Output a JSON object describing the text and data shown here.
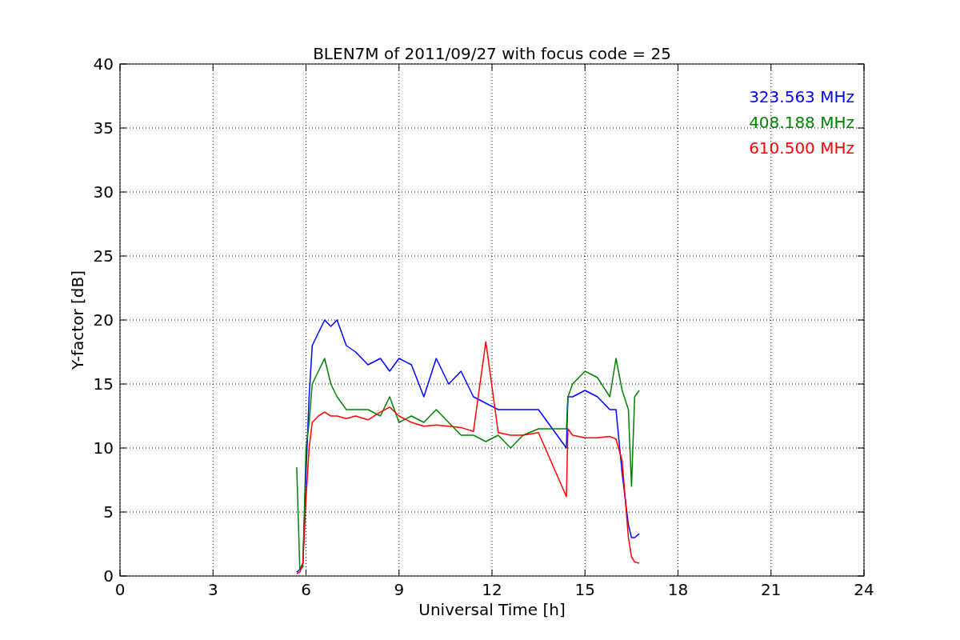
{
  "figure": {
    "chart_data": {
      "type": "line",
      "title": "BLEN7M of 2011/09/27 with focus code = 25",
      "xlabel": "Universal Time [h]",
      "ylabel": "Y-factor [dB]",
      "x": [
        5.7,
        5.8,
        5.9,
        6.0,
        6.1,
        6.2,
        6.4,
        6.6,
        6.8,
        7.0,
        7.3,
        7.6,
        8.0,
        8.4,
        8.7,
        9.0,
        9.4,
        9.8,
        10.2,
        10.6,
        11.0,
        11.4,
        11.8,
        12.2,
        12.6,
        13.0,
        13.5,
        14.4,
        14.45,
        14.6,
        15.0,
        15.4,
        15.8,
        16.0,
        16.2,
        16.4,
        16.5,
        16.6,
        16.75
      ],
      "series": [
        {
          "name": "323.563 MHz",
          "color": "#0000ff",
          "values": [
            0.3,
            0.5,
            1.0,
            8,
            14,
            18,
            19,
            20,
            19.5,
            20,
            18,
            17.5,
            16.5,
            17,
            16,
            17,
            16.5,
            14,
            17,
            15,
            16,
            14,
            13.5,
            13,
            13,
            13,
            13,
            10,
            14,
            14,
            14.5,
            14,
            13,
            13,
            8,
            4,
            3,
            3,
            3.3
          ]
        },
        {
          "name": "408.188 MHz",
          "color": "#008000",
          "values": [
            8.5,
            0.5,
            0.7,
            10,
            12,
            15,
            16,
            17,
            15,
            14,
            13,
            13,
            13,
            12.5,
            14,
            12,
            12.5,
            12,
            13,
            12,
            11,
            11,
            10.5,
            11,
            10,
            11,
            11.5,
            11.5,
            14,
            15,
            16,
            15.5,
            14,
            17,
            14.5,
            13,
            7,
            14,
            14.5
          ]
        },
        {
          "name": "610.500 MHz",
          "color": "#ff0000",
          "values": [
            0.2,
            0.3,
            1,
            6,
            10,
            12,
            12.5,
            12.8,
            12.5,
            12.5,
            12.3,
            12.5,
            12.2,
            12.8,
            13.2,
            12.5,
            12,
            11.7,
            11.8,
            11.7,
            11.6,
            11.3,
            18.3,
            11.2,
            11,
            11,
            11.2,
            6.2,
            11.5,
            11,
            10.8,
            10.8,
            10.9,
            10.7,
            9,
            3,
            1.5,
            1.1,
            1.0
          ]
        }
      ],
      "xlim": [
        0,
        24
      ],
      "ylim": [
        0,
        40
      ],
      "xticks": [
        0,
        3,
        6,
        9,
        12,
        15,
        18,
        21,
        24
      ],
      "yticks": [
        0,
        5,
        10,
        15,
        20,
        25,
        30,
        35,
        40
      ],
      "grid": true
    }
  }
}
